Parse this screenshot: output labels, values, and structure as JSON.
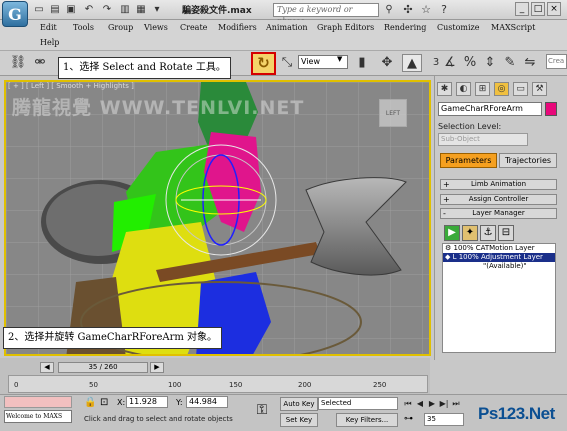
{
  "titlebar": {
    "logo": "G",
    "title": "騙姿殺文件.max",
    "search_placeholder": "Type a keyword or phrase"
  },
  "menu": [
    "Edit",
    "Tools",
    "Group",
    "Views",
    "Create",
    "Modifiers",
    "Animation",
    "Graph Editors",
    "Rendering",
    "Customize",
    "MAXScript",
    "Help"
  ],
  "toolbar": {
    "view_select": "View",
    "create_field": "Crea",
    "num3": "3"
  },
  "callouts": {
    "step1": "1、选择 Select and Rotate 工具。",
    "step2": "2、选择并旋转 GameCharRForeArm 对象。"
  },
  "viewport": {
    "label": "[ + ] [ Left ] [ Smooth + Highlights ]",
    "watermark": "腾龍視覺 WWW.TENLVI.NET",
    "viewcube": "LEFT"
  },
  "panel": {
    "object_name": "GameCharRForeArm",
    "object_color": "#e8087a",
    "selection_level": "Selection Level:",
    "sub_object": "Sub-Object",
    "tab_parameters": "Parameters",
    "tab_trajectories": "Trajectories",
    "rollouts": [
      {
        "sign": "+",
        "label": "Limb Animation"
      },
      {
        "sign": "+",
        "label": "Assign Controller"
      },
      {
        "sign": "-",
        "label": "Layer Manager"
      }
    ],
    "layers": [
      {
        "text": "⚙ 100% CATMotion Layer",
        "selected": false
      },
      {
        "text": "◆ L  100% Adjustment Layer",
        "selected": true
      },
      {
        "text": "\"(Available)\"",
        "selected": false
      }
    ]
  },
  "timeline": {
    "slider": "35 / 260",
    "ticks": [
      "0",
      "50",
      "100",
      "150",
      "200",
      "250"
    ]
  },
  "status": {
    "maxscript": "Welcome to MAXS",
    "x_label": "X:",
    "x_value": "11.928",
    "y_label": "Y:",
    "y_value": "44.984",
    "prompt": "Click and drag to select and rotate objects",
    "auto_key": "Auto Key",
    "set_key": "Set Key",
    "selected": "Selected",
    "key_filters": "Key Filters...",
    "frame": "35",
    "brand": "Ps123.Net"
  }
}
